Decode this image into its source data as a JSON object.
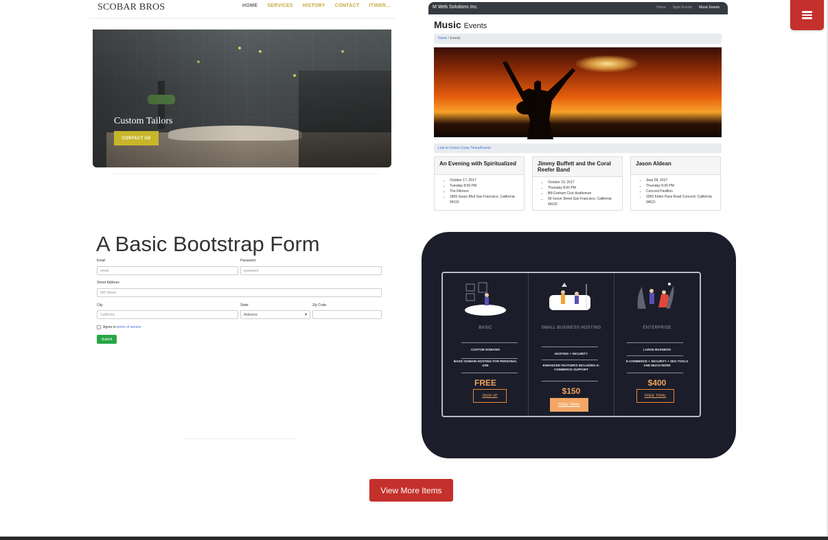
{
  "menu": {
    "icon": "hamburger-menu-icon"
  },
  "portfolio": {
    "escobar": {
      "logo": "SCOBAR BROS",
      "nav": [
        "HOME",
        "SERVICES",
        "HISTORY",
        "CONTACT",
        "ITINER..."
      ],
      "hero_title": "Custom Tailors",
      "cta": "CONTACT US"
    },
    "music": {
      "brand": "M Web Solutions Inc.",
      "nav": [
        "Home",
        "Sport Events",
        "Music Events"
      ],
      "title_bold": "Music",
      "title_rest": "Events",
      "breadcrumb_home": "Home",
      "breadcrumb_sep": "/",
      "breadcrumb_current": "Events",
      "link": "Link to Contra Costa Times/Events",
      "events": [
        {
          "name": "An Evening with Spiritualized",
          "details": [
            "October 17, 2017",
            "Tuesday 8:00 PM",
            "The Fillmore",
            "1805 Geary Blvd San Francisco, California 94115"
          ]
        },
        {
          "name": "Jimmy Buffett and the Coral Reefer Band",
          "details": [
            "October 19, 2017",
            "Thursday 8:00 PM",
            "Bill Graham Civic Auditorium",
            "99 Grove Street San Francisco, California 94102"
          ]
        },
        {
          "name": "Jason Aldean",
          "details": [
            "Sept 28, 2017",
            "Thursday 5:00 PM",
            "Concord Pavillion",
            "2000 Kirker Pass Road Concord, California 94521"
          ]
        }
      ]
    },
    "form": {
      "title": "A Basic Bootstrap Form",
      "email_label": "Email",
      "email_placeholder": "email",
      "password_label": "Password",
      "password_placeholder": "password",
      "street_label": "Street Address",
      "street_placeholder": "500 Street",
      "city_label": "City",
      "city_placeholder": "California",
      "state_label": "State",
      "state_value": "Alabama",
      "zip_label": "Zip Code",
      "agree_text": "Agree to",
      "agree_link": "terms of service",
      "submit": "Submit"
    },
    "pricing": {
      "plans": [
        {
          "name": "BASIC",
          "features": [
            "CUSTOM DOMAINS",
            "BASIC DOMAIN HOSTING FOR PERSONAL USE"
          ],
          "price": "FREE",
          "button": "SIGN UP"
        },
        {
          "name": "SMALL BUSINESS HOSTING",
          "features": [
            "HOSTING + SECURITY",
            "ENHANCED FEATURES INCLUDING E-COMMERCE SUPPORT"
          ],
          "price": "$150",
          "button": "FREE TRIAL"
        },
        {
          "name": "ENTERPRISE",
          "features": [
            "LARGE BUSINESS",
            "E-COMMERCE + SECURITY + SEO TOOLS AND MUCH MORE"
          ],
          "price": "$400",
          "button": "FREE TRIAL"
        }
      ]
    }
  },
  "view_more": "View More Items",
  "colors": {
    "accent": "#c4302b",
    "dark": "#1b1d2a",
    "gold": "#c7b62a",
    "orange": "#f0a35c",
    "green": "#28a745"
  }
}
